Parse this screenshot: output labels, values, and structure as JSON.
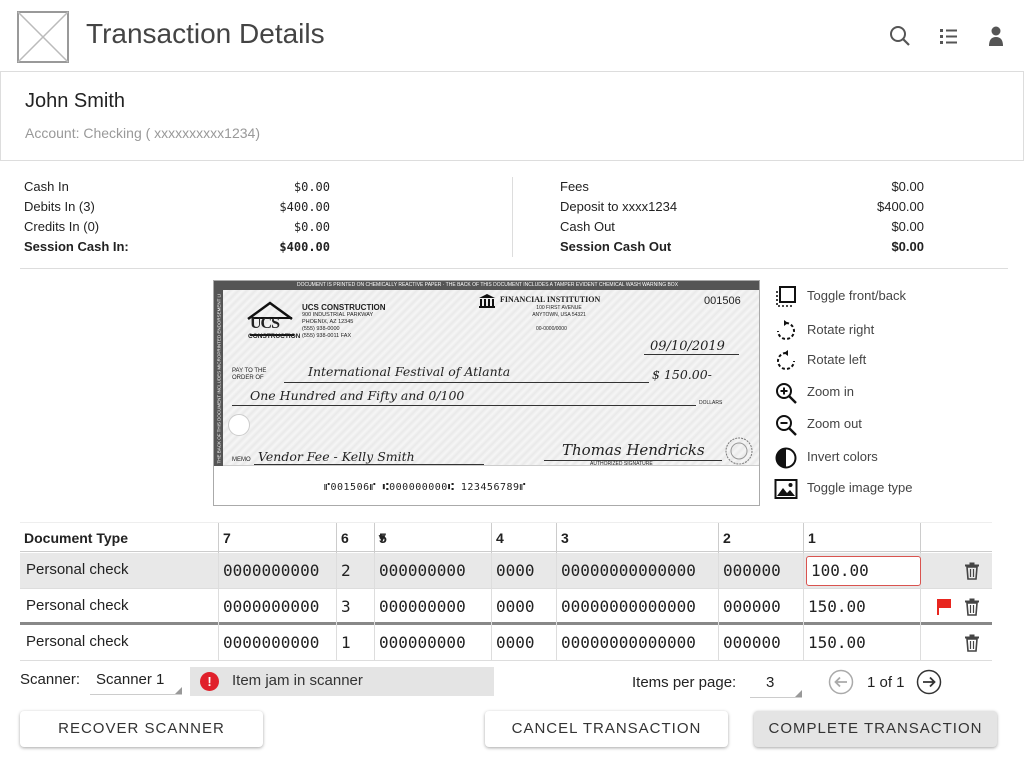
{
  "header": {
    "title": "Transaction Details"
  },
  "customer": {
    "name": "John Smith",
    "account": "Account:  Checking ( xxxxxxxxxx1234)"
  },
  "summary_left": [
    {
      "label": "Cash In",
      "value": "$0.00",
      "bold": false
    },
    {
      "label": "Debits In (3)",
      "value": "$400.00",
      "bold": false
    },
    {
      "label": "Credits In (0)",
      "value": "$0.00",
      "bold": false
    },
    {
      "label": "Session Cash In:",
      "value": "$400.00",
      "bold": true
    }
  ],
  "summary_right": [
    {
      "label": "Fees",
      "value": "$0.00",
      "bold": false
    },
    {
      "label": "Deposit to xxxx1234",
      "value": "$400.00",
      "bold": false
    },
    {
      "label": "Cash Out",
      "value": "$0.00",
      "bold": false
    },
    {
      "label": "Session Cash Out",
      "value": "$0.00",
      "bold": true
    }
  ],
  "check": {
    "top_banner": "DOCUMENT IS PRINTED ON CHEMICALLY REACTIVE PAPER · THE BACK OF THIS DOCUMENT INCLUDES A TAMPER EVIDENT CHEMICAL WASH WARNING BOX",
    "side_banner": "THE BACK OF THIS DOCUMENT INCLUDES MICROPRINTED ENDORSEMENT LINES",
    "company_logo": "UCS",
    "company_logo_sub": "CONSTRUCTION",
    "company_name": "UCS CONSTRUCTION",
    "company_address1": "900 INDUSTRIAL PARKWAY",
    "company_address2": "PHOENIX, AZ 12345",
    "company_phone": "(555) 938-0000",
    "company_fax": "(555) 938-0011 FAX",
    "bank_name": "FINANCIAL INSTITUTION",
    "bank_address1": "100 FIRST AVENUE",
    "bank_address2": "ANYTOWN, USA 54321",
    "routing_frac": "00-0000/0000",
    "check_number": "001506",
    "date": "09/10/2019",
    "pay_to_label1": "PAY TO THE",
    "pay_to_label2": "ORDER OF",
    "payee": "International Festival of Atlanta",
    "amount": "$ 150.00-",
    "written_amount": "One Hundred and Fifty and 0/100",
    "dollars_label": "DOLLARS",
    "memo_label": "MEMO",
    "memo": "Vendor Fee - Kelly Smith",
    "signature": "Thomas Hendricks",
    "signature_label": "AUTHORIZED SIGNATURE",
    "micr": "⑈001506⑈ ⑆000000000⑆ 123456789⑈"
  },
  "tools": [
    {
      "label": "Toggle front/back",
      "icon": "toggle-front-back-icon"
    },
    {
      "label": "Rotate right",
      "icon": "rotate-right-icon"
    },
    {
      "label": "Rotate left",
      "icon": "rotate-left-icon"
    },
    {
      "label": "Zoom in",
      "icon": "zoom-in-icon"
    },
    {
      "label": "Zoom out",
      "icon": "zoom-out-icon"
    },
    {
      "label": "Invert colors",
      "icon": "invert-colors-icon"
    },
    {
      "label": "Toggle image type",
      "icon": "image-icon"
    }
  ],
  "table": {
    "headers": [
      "Document Type",
      "7",
      "6",
      "5",
      "4",
      "3",
      "2",
      "1"
    ],
    "sort_indicator": "▼",
    "rows": [
      {
        "doc": "Personal check",
        "c7": "0000000000",
        "c6": "2",
        "c5": "000000000",
        "c4": "0000",
        "c3": "00000000000000",
        "c2": "000000",
        "c1": "100.00",
        "flagged": false,
        "selected": true,
        "editing": true
      },
      {
        "doc": "Personal check",
        "c7": "0000000000",
        "c6": "3",
        "c5": "000000000",
        "c4": "0000",
        "c3": "00000000000000",
        "c2": "000000",
        "c1": "150.00",
        "flagged": true,
        "selected": false,
        "editing": false
      },
      {
        "doc": "Personal check",
        "c7": "0000000000",
        "c6": "1",
        "c5": "000000000",
        "c4": "0000",
        "c3": "00000000000000",
        "c2": "000000",
        "c1": "150.00",
        "flagged": false,
        "selected": false,
        "editing": false
      }
    ]
  },
  "scanner": {
    "label": "Scanner:",
    "value": "Scanner 1",
    "status": "Item jam in scanner"
  },
  "pagination": {
    "items_label": "Items per page:",
    "items_value": "3",
    "page_text": "1 of 1"
  },
  "buttons": {
    "recover": "RECOVER SCANNER",
    "cancel": "CANCEL TRANSACTION",
    "complete": "COMPLETE TRANSACTION"
  },
  "colors": {
    "flag": "#e8261f",
    "error": "#e0202b",
    "edit_border": "#d9534f",
    "selected_row": "#e8e8e8",
    "status_bg": "#e4e4e4"
  }
}
